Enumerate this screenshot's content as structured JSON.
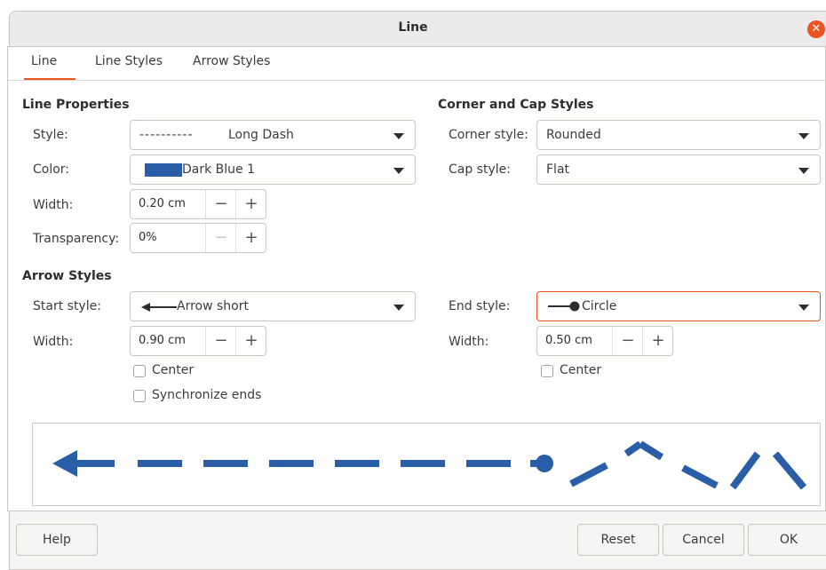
{
  "window": {
    "title": "Line",
    "close_icon": "close-icon"
  },
  "tabs": [
    {
      "label": "Line",
      "active": true
    },
    {
      "label": "Line Styles",
      "active": false
    },
    {
      "label": "Arrow Styles",
      "active": false
    }
  ],
  "line_properties": {
    "title": "Line Properties",
    "style": {
      "label": "Style:",
      "value": "Long Dash",
      "dash_preview": "----------"
    },
    "color": {
      "label": "Color:",
      "value": "Dark Blue 1",
      "swatch": "#2a5fa8"
    },
    "width": {
      "label": "Width:",
      "value": "0.20 cm"
    },
    "transparency": {
      "label": "Transparency:",
      "value": "0%"
    }
  },
  "corner_cap": {
    "title": "Corner and Cap Styles",
    "corner": {
      "label": "Corner style:",
      "value": "Rounded"
    },
    "cap": {
      "label": "Cap style:",
      "value": "Flat"
    }
  },
  "arrow_styles": {
    "title": "Arrow Styles",
    "start": {
      "label": "Start style:",
      "value": "Arrow short",
      "width_label": "Width:",
      "width": "0.90 cm",
      "center_label": "Center",
      "center_checked": false
    },
    "end": {
      "label": "End style:",
      "value": "Circle",
      "width_label": "Width:",
      "width": "0.50 cm",
      "center_label": "Center",
      "center_checked": false
    },
    "synchronize_label": "Synchronize ends",
    "synchronize_checked": false
  },
  "spin_symbols": {
    "minus": "−",
    "plus": "+"
  },
  "preview": {
    "line_color": "#2a5fa8"
  },
  "footer": {
    "help": "Help",
    "reset": "Reset",
    "cancel": "Cancel",
    "ok": "OK"
  },
  "colors": {
    "accent": "#e95420",
    "line_blue": "#2a5fa8"
  }
}
